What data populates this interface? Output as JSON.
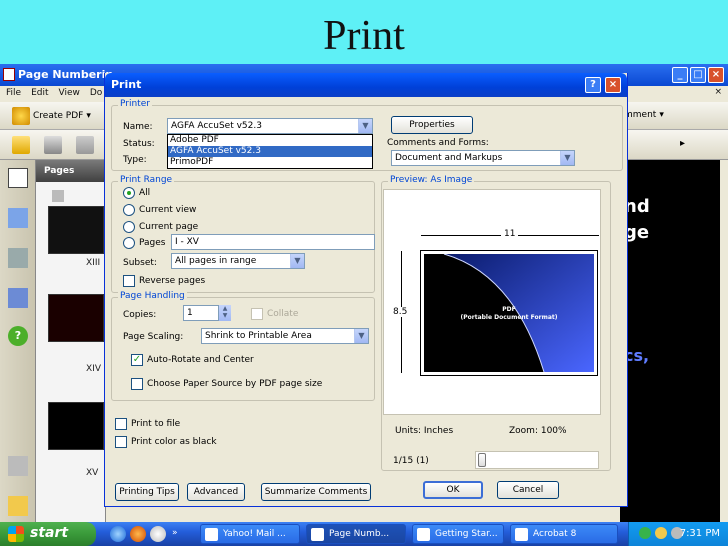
{
  "slide": {
    "title": "Print"
  },
  "app": {
    "title": "Page Numberin",
    "menu": [
      "File",
      "Edit",
      "View",
      "Do"
    ],
    "toolbar": {
      "create_pdf": "Create PDF",
      "comment": "mment"
    },
    "pages_tab": "Pages",
    "thumb_labels": [
      "XIII",
      "XIV",
      "XV"
    ],
    "doc_fragments": {
      "line1": "nd",
      "line2": "ge",
      "line3": "cs,"
    }
  },
  "dialog": {
    "title": "Print",
    "printer": {
      "group_label": "Printer",
      "name_label": "Name:",
      "name_value": "AGFA AccuSet v52.3",
      "status_label": "Status:",
      "type_label": "Type:",
      "dropdown_options": [
        "Adobe PDF",
        "AGFA AccuSet v52.3",
        "PrimoPDF"
      ],
      "selected_option_index": 1,
      "properties_button": "Properties",
      "comments_label": "Comments and Forms:",
      "comments_value": "Document and Markups"
    },
    "print_range": {
      "group_label": "Print Range",
      "all": "All",
      "current_view": "Current view",
      "current_page": "Current page",
      "pages": "Pages",
      "pages_value": "I - XV",
      "subset_label": "Subset:",
      "subset_value": "All pages in range",
      "reverse_pages": "Reverse pages"
    },
    "page_handling": {
      "group_label": "Page Handling",
      "copies_label": "Copies:",
      "copies_value": "1",
      "collate": "Collate",
      "scaling_label": "Page Scaling:",
      "scaling_value": "Shrink to Printable Area",
      "auto_rotate": "Auto-Rotate and Center",
      "choose_paper": "Choose Paper Source by PDF page size"
    },
    "print_to_file": "Print to file",
    "print_color_black": "Print color as black",
    "preview": {
      "group_label": "Preview: As Image",
      "width_dim": "11",
      "height_dim": "8.5",
      "page_title": "PDF",
      "page_subtitle": "(Portable Document Format)",
      "units": "Units: Inches",
      "zoom": "Zoom: 100%",
      "page_counter": "1/15 (1)"
    },
    "buttons": {
      "printing_tips": "Printing Tips",
      "advanced": "Advanced",
      "summarize": "Summarize Comments",
      "ok": "OK",
      "cancel": "Cancel"
    }
  },
  "taskbar": {
    "start": "start",
    "tasks": [
      "Yahoo! Mail ...",
      "Page Numb...",
      "Getting Star...",
      "Acrobat 8"
    ],
    "clock": "7:31 PM"
  }
}
